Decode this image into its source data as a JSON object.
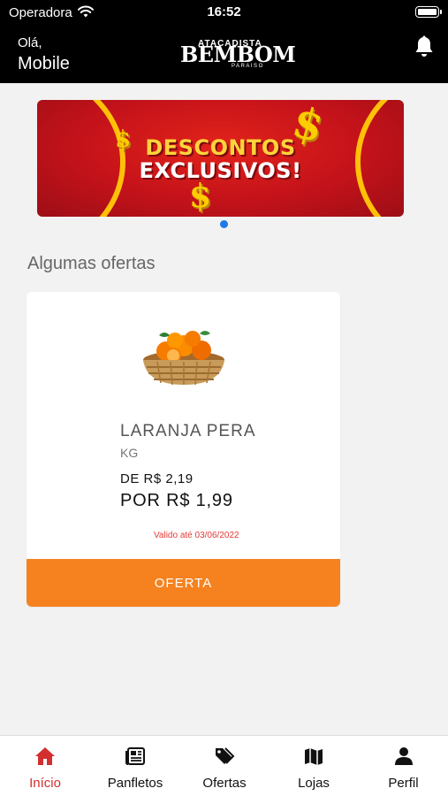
{
  "status_bar": {
    "carrier": "Operadora",
    "time": "16:52"
  },
  "header": {
    "greeting": "Olá,",
    "user_name": "Mobile",
    "logo": {
      "small": "ATACADISTA",
      "main": "BEMBOM",
      "sub": "PARAISO"
    }
  },
  "banner": {
    "line1": "DESCONTOS",
    "line2": "EXCLUSIVOS!",
    "coin_symbol": "$"
  },
  "section": {
    "title": "Algumas ofertas"
  },
  "product": {
    "name": "LARANJA PERA",
    "unit": "KG",
    "price_from": "DE R$ 2,19",
    "price_to": "POR R$ 1,99",
    "valid_until": "Valido até 03/06/2022",
    "offer_button": "OFERTA"
  },
  "tabs": [
    {
      "label": "Início",
      "icon": "home-icon",
      "active": true
    },
    {
      "label": "Panfletos",
      "icon": "newspaper-icon",
      "active": false
    },
    {
      "label": "Ofertas",
      "icon": "tag-icon",
      "active": false
    },
    {
      "label": "Lojas",
      "icon": "map-icon",
      "active": false
    },
    {
      "label": "Perfil",
      "icon": "user-icon",
      "active": false
    }
  ],
  "colors": {
    "accent": "#f5821f",
    "active_tab": "#d32f2f",
    "banner_red": "#c4121a",
    "banner_gold": "#ffc107",
    "pager_dot": "#1e7be6"
  }
}
